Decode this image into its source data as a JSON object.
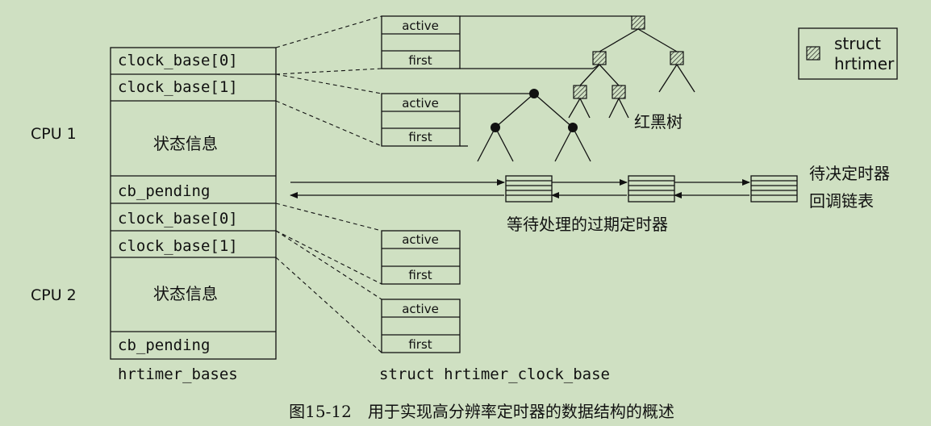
{
  "caption": "图15-12　用于实现高分辨率定时器的数据结构的概述",
  "legend": {
    "line1": "struct",
    "line2": "hrtimer"
  },
  "cpu_labels": [
    "CPU 1",
    "CPU 2"
  ],
  "bases": {
    "cpu1": {
      "clock_base_0": "clock_base[0]",
      "clock_base_1": "clock_base[1]",
      "state": "状态信息",
      "cb_pending": "cb_pending"
    },
    "cpu2": {
      "clock_base_0": "clock_base[0]",
      "clock_base_1": "clock_base[1]",
      "state": "状态信息",
      "cb_pending": "cb_pending"
    },
    "label": "hrtimer_bases"
  },
  "clock_base_boxes": [
    {
      "active": "active",
      "first": "first"
    },
    {
      "active": "active",
      "first": "first"
    },
    {
      "active": "active",
      "first": "first"
    },
    {
      "active": "active",
      "first": "first"
    }
  ],
  "clock_base_label": "struct hrtimer_clock_base",
  "rbtree_label": "红黑树",
  "pending_label": "等待处理的过期定时器",
  "list_label": {
    "line1": "待决定时器",
    "line2": "回调链表"
  }
}
